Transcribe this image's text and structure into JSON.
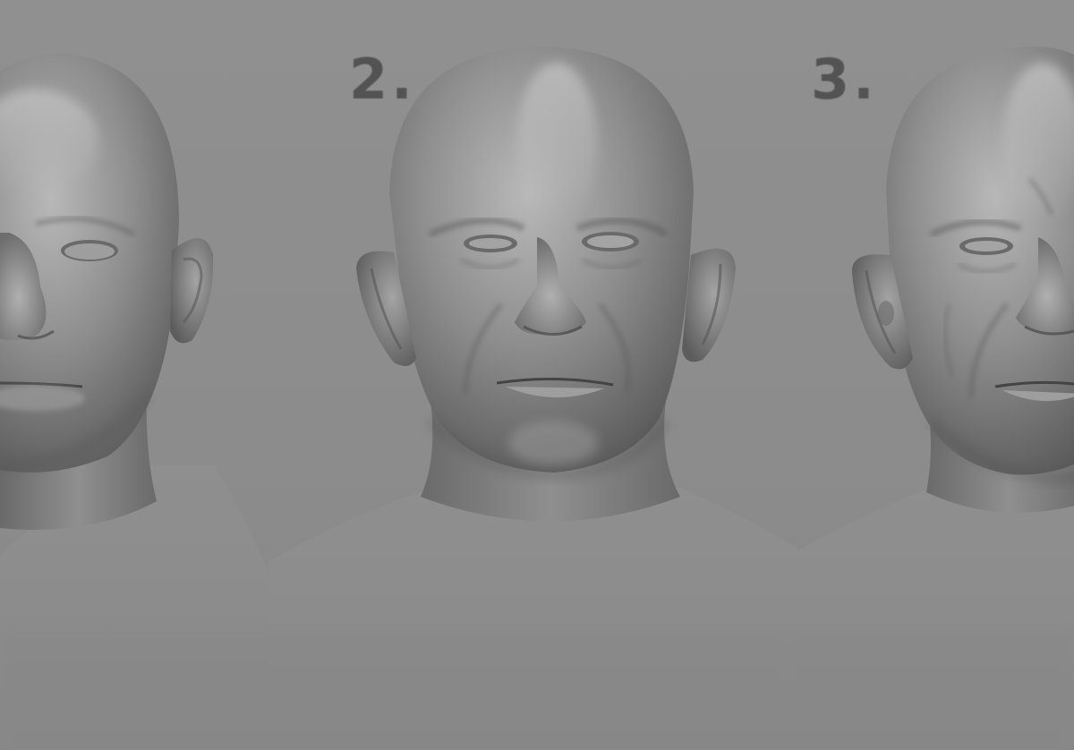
{
  "labels": {
    "step_2": "2.",
    "step_3": "3."
  },
  "colors": {
    "background": "#8d8d8d",
    "sculpt_base": "#8a8a8a",
    "sculpt_highlight": "#b4b4b4",
    "sculpt_shadow": "#4a4a4a",
    "label": "#4e4e4e"
  },
  "sculpts": [
    {
      "id": "head-1",
      "description_visible": false
    },
    {
      "id": "head-2",
      "description_visible": false
    },
    {
      "id": "head-3",
      "description_visible": false
    }
  ]
}
